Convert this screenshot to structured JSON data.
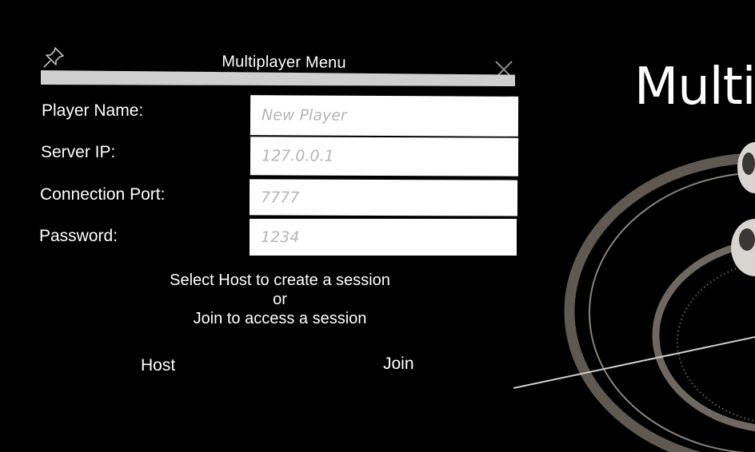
{
  "panel": {
    "title": "Multiplayer Menu",
    "icons": {
      "pin": "pin-icon",
      "close": "close-icon"
    }
  },
  "fields": {
    "player_name": {
      "label": "Player Name:",
      "placeholder": "New Player",
      "value": ""
    },
    "server_ip": {
      "label": "Server IP:",
      "placeholder": "127.0.0.1",
      "value": ""
    },
    "connection_port": {
      "label": "Connection Port:",
      "placeholder": "7777",
      "value": ""
    },
    "password": {
      "label": "Password:",
      "placeholder": "1234",
      "value": ""
    }
  },
  "instructions": {
    "line1": "Select Host to create a session",
    "line2": "or",
    "line3": "Join to access a session"
  },
  "buttons": {
    "host": "Host",
    "join": "Join"
  },
  "background": {
    "title_fragment": "Multi"
  },
  "colors": {
    "background": "#000000",
    "panel_text": "#ffffff",
    "title_bar": "#cfcfcf",
    "input_bg": "#ffffff",
    "placeholder": "#b5b5b5",
    "ring": "#6e6860"
  }
}
